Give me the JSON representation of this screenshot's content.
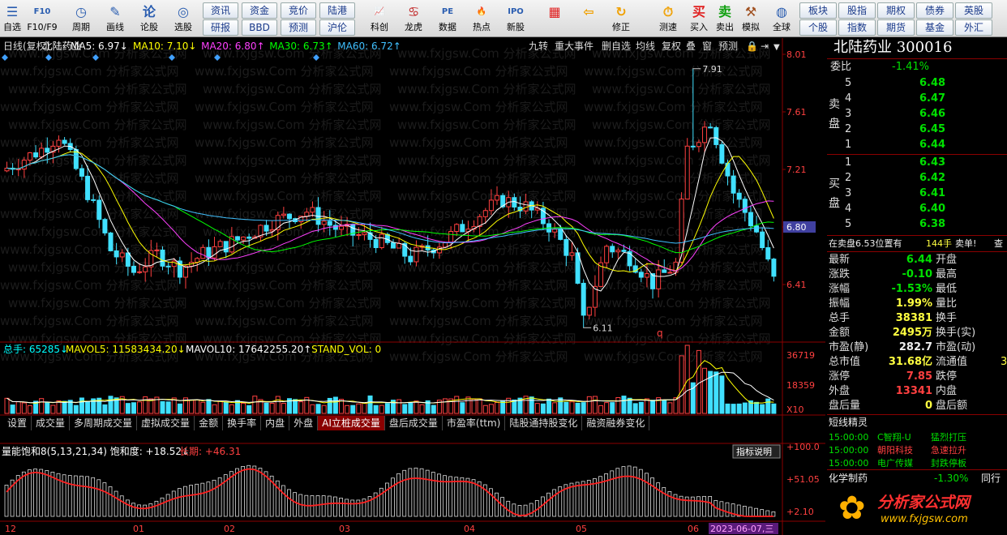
{
  "toolbar": {
    "items": [
      {
        "label": "自选",
        "icon": "☰",
        "icon_name": "watchlist-icon",
        "color": "#2a5db0"
      },
      {
        "label": "F10/F9",
        "icon": "F10",
        "icon_name": "f10-icon",
        "color": "#2a5db0"
      },
      {
        "label": "周期",
        "icon": "◷",
        "icon_name": "period-clock-icon",
        "color": "#2a5db0"
      },
      {
        "label": "画线",
        "icon": "✎",
        "icon_name": "draw-line-icon",
        "color": "#2a5db0"
      },
      {
        "label": "论股",
        "icon": "论",
        "icon_name": "discuss-icon",
        "color": "#2a5db0"
      },
      {
        "label": "选股",
        "icon": "◎",
        "icon_name": "stock-picker-icon",
        "color": "#2a5db0"
      },
      {
        "label": "科创",
        "icon": "📈",
        "icon_name": "star-market-icon",
        "color": "#2a5db0"
      },
      {
        "label": "龙虎",
        "icon": "♋",
        "icon_name": "dragon-tiger-icon",
        "color": "#c02020"
      },
      {
        "label": "数据",
        "icon": "PE",
        "icon_name": "data-pe-icon",
        "color": "#2a5db0"
      },
      {
        "label": "热点",
        "icon": "🔥",
        "icon_name": "hotspot-icon",
        "color": "#e04000"
      },
      {
        "label": "新股",
        "icon": "IPO",
        "icon_name": "ipo-icon",
        "color": "#2a5db0"
      },
      {
        "label": "",
        "icon": "▦",
        "icon_name": "color-grid-icon",
        "color": "#e02020"
      },
      {
        "label": "",
        "icon": "⇦",
        "icon_name": "back-arrow-icon",
        "color": "#f0a000"
      },
      {
        "label": "修正",
        "icon": "↻",
        "icon_name": "adjust-icon",
        "color": "#f0a000"
      },
      {
        "label": "测速",
        "icon": "⏱",
        "icon_name": "speed-test-icon",
        "color": "#f0a000"
      },
      {
        "label": "买入",
        "icon": "买",
        "icon_name": "buy-icon",
        "color": "#e02020"
      },
      {
        "label": "卖出",
        "icon": "卖",
        "icon_name": "sell-icon",
        "color": "#10a010"
      },
      {
        "label": "模拟",
        "icon": "⚒",
        "icon_name": "simulate-hammer-icon",
        "color": "#a05020"
      },
      {
        "label": "全球",
        "icon": "◍",
        "icon_name": "globe-icon",
        "color": "#2a5db0"
      }
    ],
    "small_buttons": [
      {
        "label": "资讯"
      },
      {
        "label": "资金"
      },
      {
        "label": "竞价"
      },
      {
        "label": "陆港"
      },
      {
        "label": "研报"
      },
      {
        "label": "BBD"
      },
      {
        "label": "预测"
      },
      {
        "label": "沪伦"
      },
      {
        "label": "板块"
      },
      {
        "label": "股指"
      },
      {
        "label": "期权"
      },
      {
        "label": "债券"
      },
      {
        "label": "英股"
      },
      {
        "label": "个股"
      },
      {
        "label": "指数"
      },
      {
        "label": "期货"
      },
      {
        "label": "基金"
      },
      {
        "label": "外汇"
      }
    ]
  },
  "chart": {
    "title": "日线(复权)",
    "stock_name": "北陆药业",
    "ma": [
      {
        "label": "MA5: 6.97",
        "arrow": "↓",
        "color": "#ffffff"
      },
      {
        "label": "MA10: 7.10",
        "arrow": "↓",
        "color": "#ffff00"
      },
      {
        "label": "MA20: 6.80",
        "arrow": "↑",
        "color": "#ff40ff"
      },
      {
        "label": "MA30: 6.73",
        "arrow": "↑",
        "color": "#00ff00"
      },
      {
        "label": "MA60: 6.72",
        "arrow": "↑",
        "color": "#40c0ff"
      }
    ],
    "top_tabs": [
      "九转",
      "重大事件",
      "删自选",
      "均线",
      "复权",
      "叠",
      "窗",
      "预测"
    ],
    "price_axis": [
      "8.01",
      "7.61",
      "7.21",
      "6.80",
      "6.41"
    ],
    "current_price_tag": "6.80",
    "high_label": "7.91",
    "low_label": "6.11",
    "q_mark": "q",
    "watermark": "www.fxjgsw.Com 分析家公式网",
    "volume_header": [
      {
        "label": "总手: 65285",
        "arrow": "↓",
        "color": "#00ffff"
      },
      {
        "label": "MAVOL5: 11583434.20",
        "arrow": "↓",
        "color": "#ffff00"
      },
      {
        "label": "MAVOL10: 17642255.20",
        "arrow": "↑",
        "color": "#ffffff"
      },
      {
        "label": "STAND_VOL: 0",
        "arrow": "",
        "color": "#ffff00"
      }
    ],
    "volume_axis": [
      "36719",
      "18359",
      "X10"
    ],
    "tabs": [
      "设置",
      "成交量",
      "多周期成交量",
      "虚拟成交量",
      "金额",
      "换手率",
      "内盘",
      "外盘",
      "AI立桩成交量",
      "盘后成交量",
      "市盈率(ttm)",
      "陆股通持股变化",
      "融资融券变化"
    ],
    "active_tab": "AI立桩成交量",
    "indicator_header": {
      "part1": "量能饱和8(5,13,21,34) 饱和度: +18.52",
      "arrow": "↓",
      "part2": "长期: +46.31"
    },
    "indicator_button": "指标说明",
    "indicator_axis": [
      "+100.0",
      "+51.05",
      "+2.10"
    ],
    "date_axis": [
      "12",
      "01",
      "02",
      "03",
      "04",
      "05",
      "06"
    ],
    "cursor_date": "2023-06-07,三"
  },
  "quote": {
    "name": "北陆药业",
    "code": "300016",
    "wei_bi_label": "委比",
    "wei_bi": "-1.41%",
    "sell_label": "卖盘",
    "buy_label": "买盘",
    "asks": [
      {
        "n": "5",
        "p": "6.48"
      },
      {
        "n": "4",
        "p": "6.47"
      },
      {
        "n": "3",
        "p": "6.46"
      },
      {
        "n": "2",
        "p": "6.45"
      },
      {
        "n": "1",
        "p": "6.44"
      }
    ],
    "bids": [
      {
        "n": "1",
        "p": "6.43"
      },
      {
        "n": "2",
        "p": "6.42"
      },
      {
        "n": "3",
        "p": "6.41"
      },
      {
        "n": "4",
        "p": "6.40"
      },
      {
        "n": "5",
        "p": "6.38"
      }
    ],
    "notice": "在卖盘6.53位置有",
    "notice_vol": "144手",
    "notice_tag": "卖单!",
    "notice_more": "查",
    "stats": [
      {
        "k": "最新",
        "v": "6.44",
        "vc": "grn",
        "k2": "开盘",
        "v2": ""
      },
      {
        "k": "涨跌",
        "v": "-0.10",
        "vc": "grn",
        "k2": "最高",
        "v2": ""
      },
      {
        "k": "涨幅",
        "v": "-1.53%",
        "vc": "grn",
        "k2": "最低",
        "v2": ""
      },
      {
        "k": "振幅",
        "v": "1.99%",
        "vc": "yel",
        "k2": "量比",
        "v2": ""
      },
      {
        "k": "总手",
        "v": "38381",
        "vc": "yel",
        "k2": "换手",
        "v2": ""
      },
      {
        "k": "金额",
        "v": "2495万",
        "vc": "yel",
        "k2": "换手(实)",
        "v2": ""
      },
      {
        "k": "市盈(静)",
        "v": "282.7",
        "vc": "wht",
        "k2": "市盈(动)",
        "v2": ""
      },
      {
        "k": "总市值",
        "v": "31.68亿",
        "vc": "yel",
        "k2": "流通值",
        "v2": "3"
      },
      {
        "k": "涨停",
        "v": "7.85",
        "vc": "red",
        "k2": "跌停",
        "v2": ""
      },
      {
        "k": "外盘",
        "v": "13341",
        "vc": "red",
        "k2": "内盘",
        "v2": ""
      },
      {
        "k": "盘后量",
        "v": "0",
        "vc": "yel",
        "k2": "盘后额",
        "v2": ""
      }
    ],
    "spirit_title": "短线精灵",
    "spirit": [
      {
        "t": "15:00:00",
        "n": "C智翔-U",
        "s": "猛烈打压",
        "c": "grn"
      },
      {
        "t": "15:00:00",
        "n": "朝阳科技",
        "s": "急速拉升",
        "c": "red"
      },
      {
        "t": "15:00:00",
        "n": "电广传媒",
        "s": "封跌停板",
        "c": "grn"
      }
    ],
    "sector": "化学制药",
    "sector_chg": "-1.30%",
    "sector_more": "同行",
    "logo_text": "分析家公式网",
    "logo_url": "www.fxjgsw.com"
  }
}
